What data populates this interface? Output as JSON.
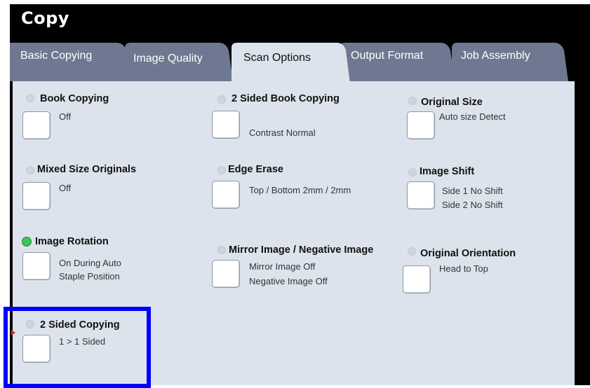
{
  "title": "Copy",
  "tabs": [
    "Basic Copying",
    "Image Quality",
    "Scan Options",
    "Output Format",
    "Job Assembly"
  ],
  "active_tab": "Scan Options",
  "colors": {
    "frame": "#000000",
    "tab_inactive": "#6e7890",
    "panel": "#dde3ec",
    "selected_indicator": "#3ec45a",
    "highlight": "#0000ff",
    "pointer": "#d9262c"
  },
  "options": [
    {
      "label": "Book Copying",
      "values": [
        "Off"
      ],
      "selected": false
    },
    {
      "label": "Mixed Size Originals",
      "values": [
        "Off"
      ],
      "selected": false
    },
    {
      "label": "Image Rotation",
      "values": [
        "On During Auto",
        "Staple Position"
      ],
      "selected": true
    },
    {
      "label": "2 Sided Copying",
      "values": [
        "1 > 1 Sided"
      ],
      "selected": false
    },
    {
      "label": "2 Sided Book Copying",
      "values": [
        "Contrast Normal"
      ],
      "selected": false
    },
    {
      "label": "Edge Erase",
      "values": [
        "Top / Bottom 2mm / 2mm"
      ],
      "selected": false
    },
    {
      "label": "Mirror Image / Negative Image",
      "values": [
        "Mirror Image Off",
        "Negative Image Off"
      ],
      "selected": false
    },
    {
      "label": "Original Size",
      "values": [
        "Auto size Detect"
      ],
      "selected": false
    },
    {
      "label": "Image Shift",
      "values": [
        "Side 1 No Shift",
        "Side 2 No Shift"
      ],
      "selected": false
    },
    {
      "label": "Original Orientation",
      "values": [
        "Head to Top"
      ],
      "selected": false
    }
  ]
}
